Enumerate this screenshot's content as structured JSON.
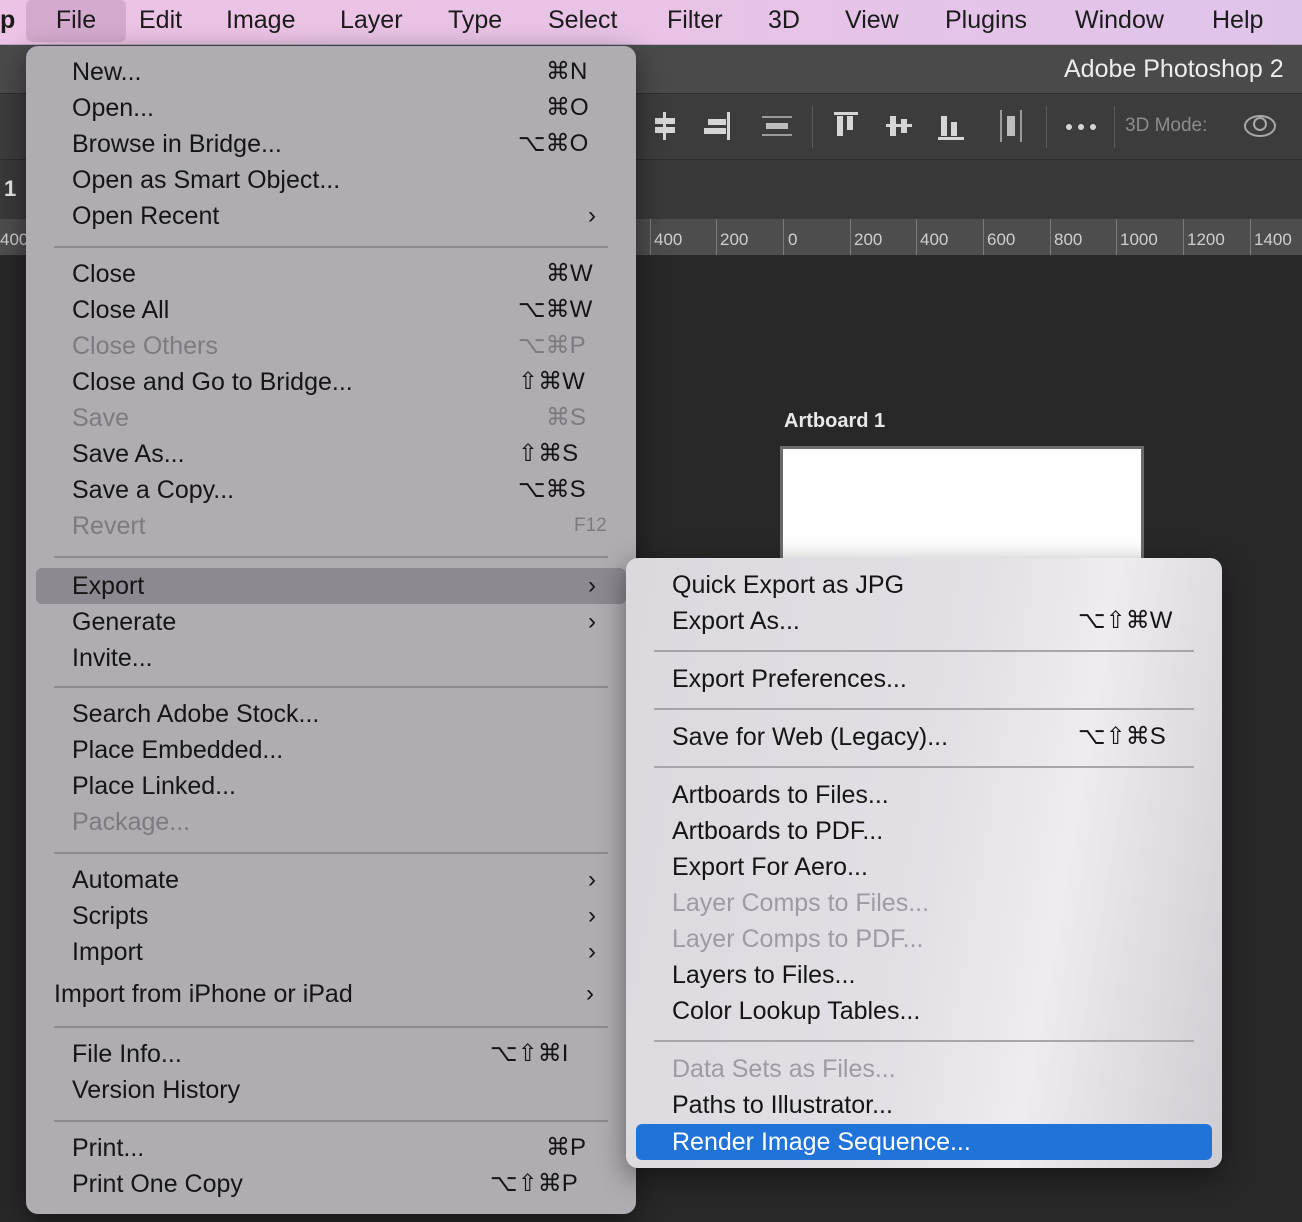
{
  "menubar": {
    "app_label": "p",
    "items": [
      "File",
      "Edit",
      "Image",
      "Layer",
      "Type",
      "Select",
      "Filter",
      "3D",
      "View",
      "Plugins",
      "Window",
      "Help"
    ]
  },
  "window": {
    "title": "Adobe Photoshop 2",
    "mode_label": "3D Mode:",
    "side_text": "1"
  },
  "ruler": {
    "labels": [
      "400",
      "400",
      "200",
      "0",
      "200",
      "400",
      "600",
      "800",
      "1000",
      "1200",
      "1400"
    ]
  },
  "artboard": {
    "label": "Artboard 1"
  },
  "file_menu": {
    "items": [
      {
        "label": "New...",
        "shortcut": "⌘N"
      },
      {
        "label": "Open...",
        "shortcut": "⌘O"
      },
      {
        "label": "Browse in Bridge...",
        "shortcut": "⌥⌘O"
      },
      {
        "label": "Open as Smart Object...",
        "shortcut": ""
      },
      {
        "label": "Open Recent",
        "shortcut": "",
        "submenu": true
      },
      {
        "label": "Close",
        "shortcut": "⌘W"
      },
      {
        "label": "Close All",
        "shortcut": "⌥⌘W"
      },
      {
        "label": "Close Others",
        "shortcut": "⌥⌘P",
        "disabled": true
      },
      {
        "label": "Close and Go to Bridge...",
        "shortcut": "⇧⌘W"
      },
      {
        "label": "Save",
        "shortcut": "⌘S",
        "disabled": true
      },
      {
        "label": "Save As...",
        "shortcut": "⇧⌘S"
      },
      {
        "label": "Save a Copy...",
        "shortcut": "⌥⌘S"
      },
      {
        "label": "Revert",
        "shortcut": "F12",
        "disabled": true
      },
      {
        "label": "Export",
        "shortcut": "",
        "submenu": true,
        "highlighted": true
      },
      {
        "label": "Generate",
        "shortcut": "",
        "submenu": true
      },
      {
        "label": "Invite...",
        "shortcut": ""
      },
      {
        "label": "Search Adobe Stock...",
        "shortcut": ""
      },
      {
        "label": "Place Embedded...",
        "shortcut": ""
      },
      {
        "label": "Place Linked...",
        "shortcut": ""
      },
      {
        "label": "Package...",
        "shortcut": "",
        "disabled": true
      },
      {
        "label": "Automate",
        "shortcut": "",
        "submenu": true
      },
      {
        "label": "Scripts",
        "shortcut": "",
        "submenu": true
      },
      {
        "label": "Import",
        "shortcut": "",
        "submenu": true
      },
      {
        "label": "Import from iPhone or iPad",
        "shortcut": "",
        "submenu": true
      },
      {
        "label": "File Info...",
        "shortcut": "⌥⇧⌘I"
      },
      {
        "label": "Version History",
        "shortcut": ""
      },
      {
        "label": "Print...",
        "shortcut": "⌘P"
      },
      {
        "label": "Print One Copy",
        "shortcut": "⌥⇧⌘P"
      }
    ]
  },
  "export_menu": {
    "items": [
      {
        "label": "Quick Export as JPG",
        "shortcut": ""
      },
      {
        "label": "Export As...",
        "shortcut": "⌥⇧⌘W"
      },
      {
        "label": "Export Preferences...",
        "shortcut": ""
      },
      {
        "label": "Save for Web (Legacy)...",
        "shortcut": "⌥⇧⌘S"
      },
      {
        "label": "Artboards to Files...",
        "shortcut": ""
      },
      {
        "label": "Artboards to PDF...",
        "shortcut": ""
      },
      {
        "label": "Export For Aero...",
        "shortcut": ""
      },
      {
        "label": "Layer Comps to Files...",
        "shortcut": "",
        "disabled": true
      },
      {
        "label": "Layer Comps to PDF...",
        "shortcut": "",
        "disabled": true
      },
      {
        "label": "Layers to Files...",
        "shortcut": ""
      },
      {
        "label": "Color Lookup Tables...",
        "shortcut": ""
      },
      {
        "label": "Data Sets as Files...",
        "shortcut": "",
        "disabled": true
      },
      {
        "label": "Paths to Illustrator...",
        "shortcut": ""
      },
      {
        "label": "Render Image Sequence...",
        "shortcut": "",
        "selected": true
      }
    ]
  }
}
